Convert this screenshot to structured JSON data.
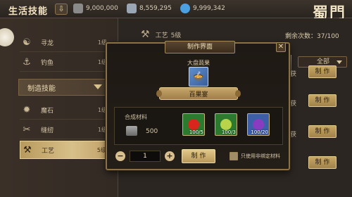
{
  "topbar": {
    "title": "生活技能",
    "currencies": [
      {
        "icon": "diamond-icon",
        "value": "9,000,000",
        "color": "#8a8a8a"
      },
      {
        "icon": "silver-icon",
        "value": "8,559,295",
        "color": "#9aa6b4"
      },
      {
        "icon": "gem-icon",
        "value": "9,999,342",
        "color": "#4aa0e0"
      }
    ],
    "logo": "蜀門"
  },
  "sidebar": {
    "items": [
      {
        "name": "寻龙",
        "level": "1级",
        "icon": "dragon-icon"
      },
      {
        "name": "钓鱼",
        "level": "1级",
        "icon": "fishing-icon"
      }
    ],
    "section": "制造技能",
    "craft_items": [
      {
        "name": "魔石",
        "level": "1级",
        "icon": "magic-stone-icon"
      },
      {
        "name": "缝纫",
        "level": "1级",
        "icon": "scissors-icon"
      },
      {
        "name": "工艺",
        "level": "5级",
        "icon": "hammer-icon"
      }
    ]
  },
  "main": {
    "skill_label": "工艺",
    "skill_level": "5级",
    "remaining_label": "剩余次数：37/100",
    "filter": "全部",
    "row_buttons": [
      "制 作",
      "制 作",
      "制 作",
      "制 作"
    ],
    "row_sides": [
      "获",
      "获",
      "获"
    ]
  },
  "modal": {
    "title": "制作界面",
    "featured_name": "大盘蔬果",
    "scroll_label": "百果宴",
    "materials_label": "合成材料",
    "coin_value": "500",
    "materials": [
      {
        "icon": "apple-icon",
        "qty": "100/5",
        "color": "#d8261c"
      },
      {
        "icon": "pear-icon",
        "qty": "100/3",
        "color": "#b8d44a"
      },
      {
        "icon": "grape-icon",
        "qty": "100/20",
        "color": "#8a3cc0"
      }
    ],
    "quantity": "1",
    "make_label": "制 作",
    "bound_label": "只使用非绑定材料"
  }
}
